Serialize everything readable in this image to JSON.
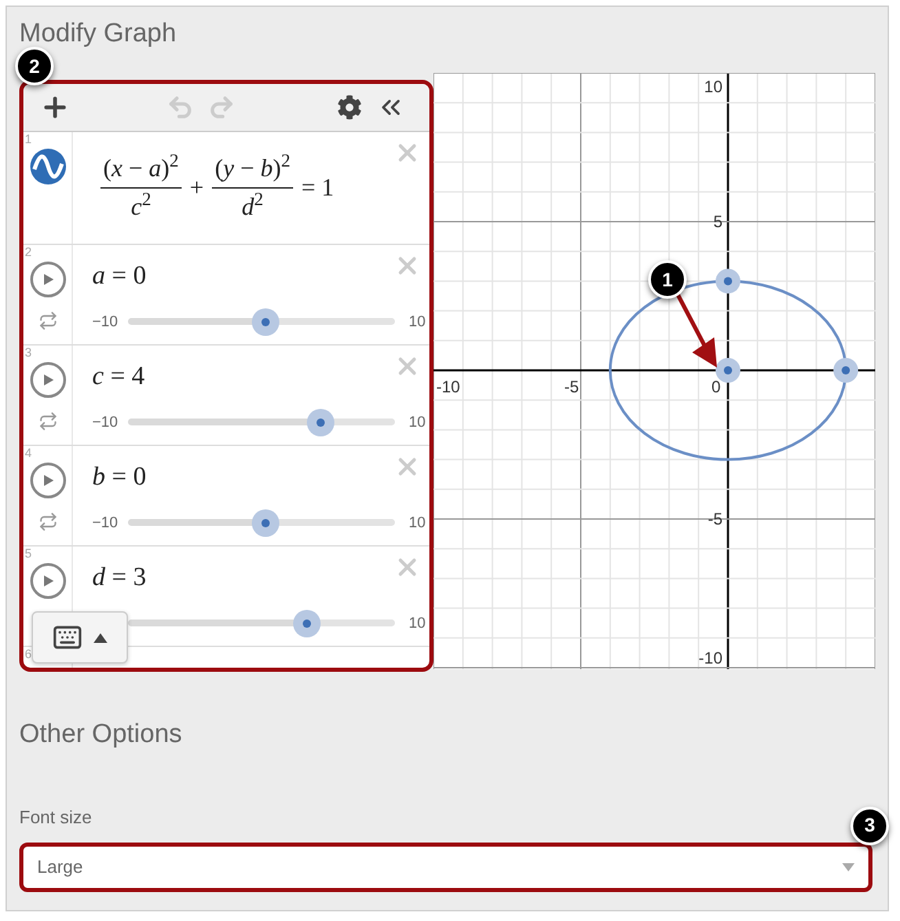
{
  "title": "Modify Graph",
  "expression_panel": {
    "callout": "2",
    "toolbar": {
      "undo": {
        "disabled": true
      },
      "redo": {
        "disabled": true
      }
    },
    "expressions": [
      {
        "kind": "formula",
        "number": "1",
        "num1": "(*x* − *a*)$^{2}$",
        "den1": "*c*$^{2}$",
        "op": "+",
        "num2": "(*y* − *b*)$^{2}$",
        "den2": "*d*$^{2}$",
        "rhs": "= 1"
      },
      {
        "kind": "slider",
        "number": "2",
        "text": "*a* = 0",
        "min": "−10",
        "max": "10",
        "level": 0.5
      },
      {
        "kind": "slider",
        "number": "3",
        "text": "*c* = 4",
        "min": "−10",
        "max": "10",
        "level": 0.7
      },
      {
        "kind": "slider",
        "number": "4",
        "text": "*b* = 0",
        "min": "−10",
        "max": "10",
        "level": 0.5
      },
      {
        "kind": "slider",
        "number": "5",
        "text": "*d* = 3",
        "max": "10",
        "level": 0.65
      },
      {
        "kind": "cutoff",
        "number": "6"
      }
    ]
  },
  "graph": {
    "callout": "1",
    "x_tick_labels": [
      "-10",
      "-5",
      "0"
    ],
    "y_tick_labels": [
      "10",
      "5",
      "-5",
      "-10"
    ]
  },
  "other_options": {
    "heading": "Other Options",
    "font_size": {
      "label": "Font size",
      "value": "Large",
      "callout": "3"
    }
  }
}
